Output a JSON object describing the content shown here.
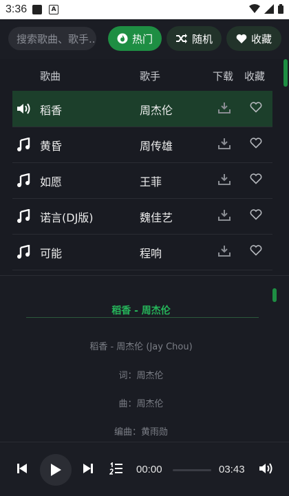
{
  "status_bar": {
    "time": "3:36",
    "app_badge": "A"
  },
  "search": {
    "placeholder": "搜索歌曲、歌手..."
  },
  "filters": {
    "hot": "热门",
    "random": "随机",
    "favorites": "收藏"
  },
  "table": {
    "headers": {
      "song": "歌曲",
      "artist": "歌手",
      "download": "下载",
      "favorite": "收藏"
    },
    "rows": [
      {
        "song": "稻香",
        "artist": "周杰伦",
        "playing": true
      },
      {
        "song": "黄昏",
        "artist": "周传雄",
        "playing": false
      },
      {
        "song": "如愿",
        "artist": "王菲",
        "playing": false
      },
      {
        "song": "诺言(DJ版)",
        "artist": "魏佳艺",
        "playing": false
      },
      {
        "song": "可能",
        "artist": "程响",
        "playing": false
      }
    ]
  },
  "lyrics": {
    "title": "稻香 - 周杰伦",
    "lines": [
      "稻香 - 周杰伦 (Jay Chou)",
      "词：周杰伦",
      "曲：周杰伦",
      "编曲：黄雨勋"
    ]
  },
  "player": {
    "current_time": "00:00",
    "duration": "03:43",
    "progress": 0
  },
  "colors": {
    "accent": "#1e8e43",
    "lyric_title": "#26b45a",
    "active_row": "#1c3f2b",
    "background": "#191b22"
  }
}
